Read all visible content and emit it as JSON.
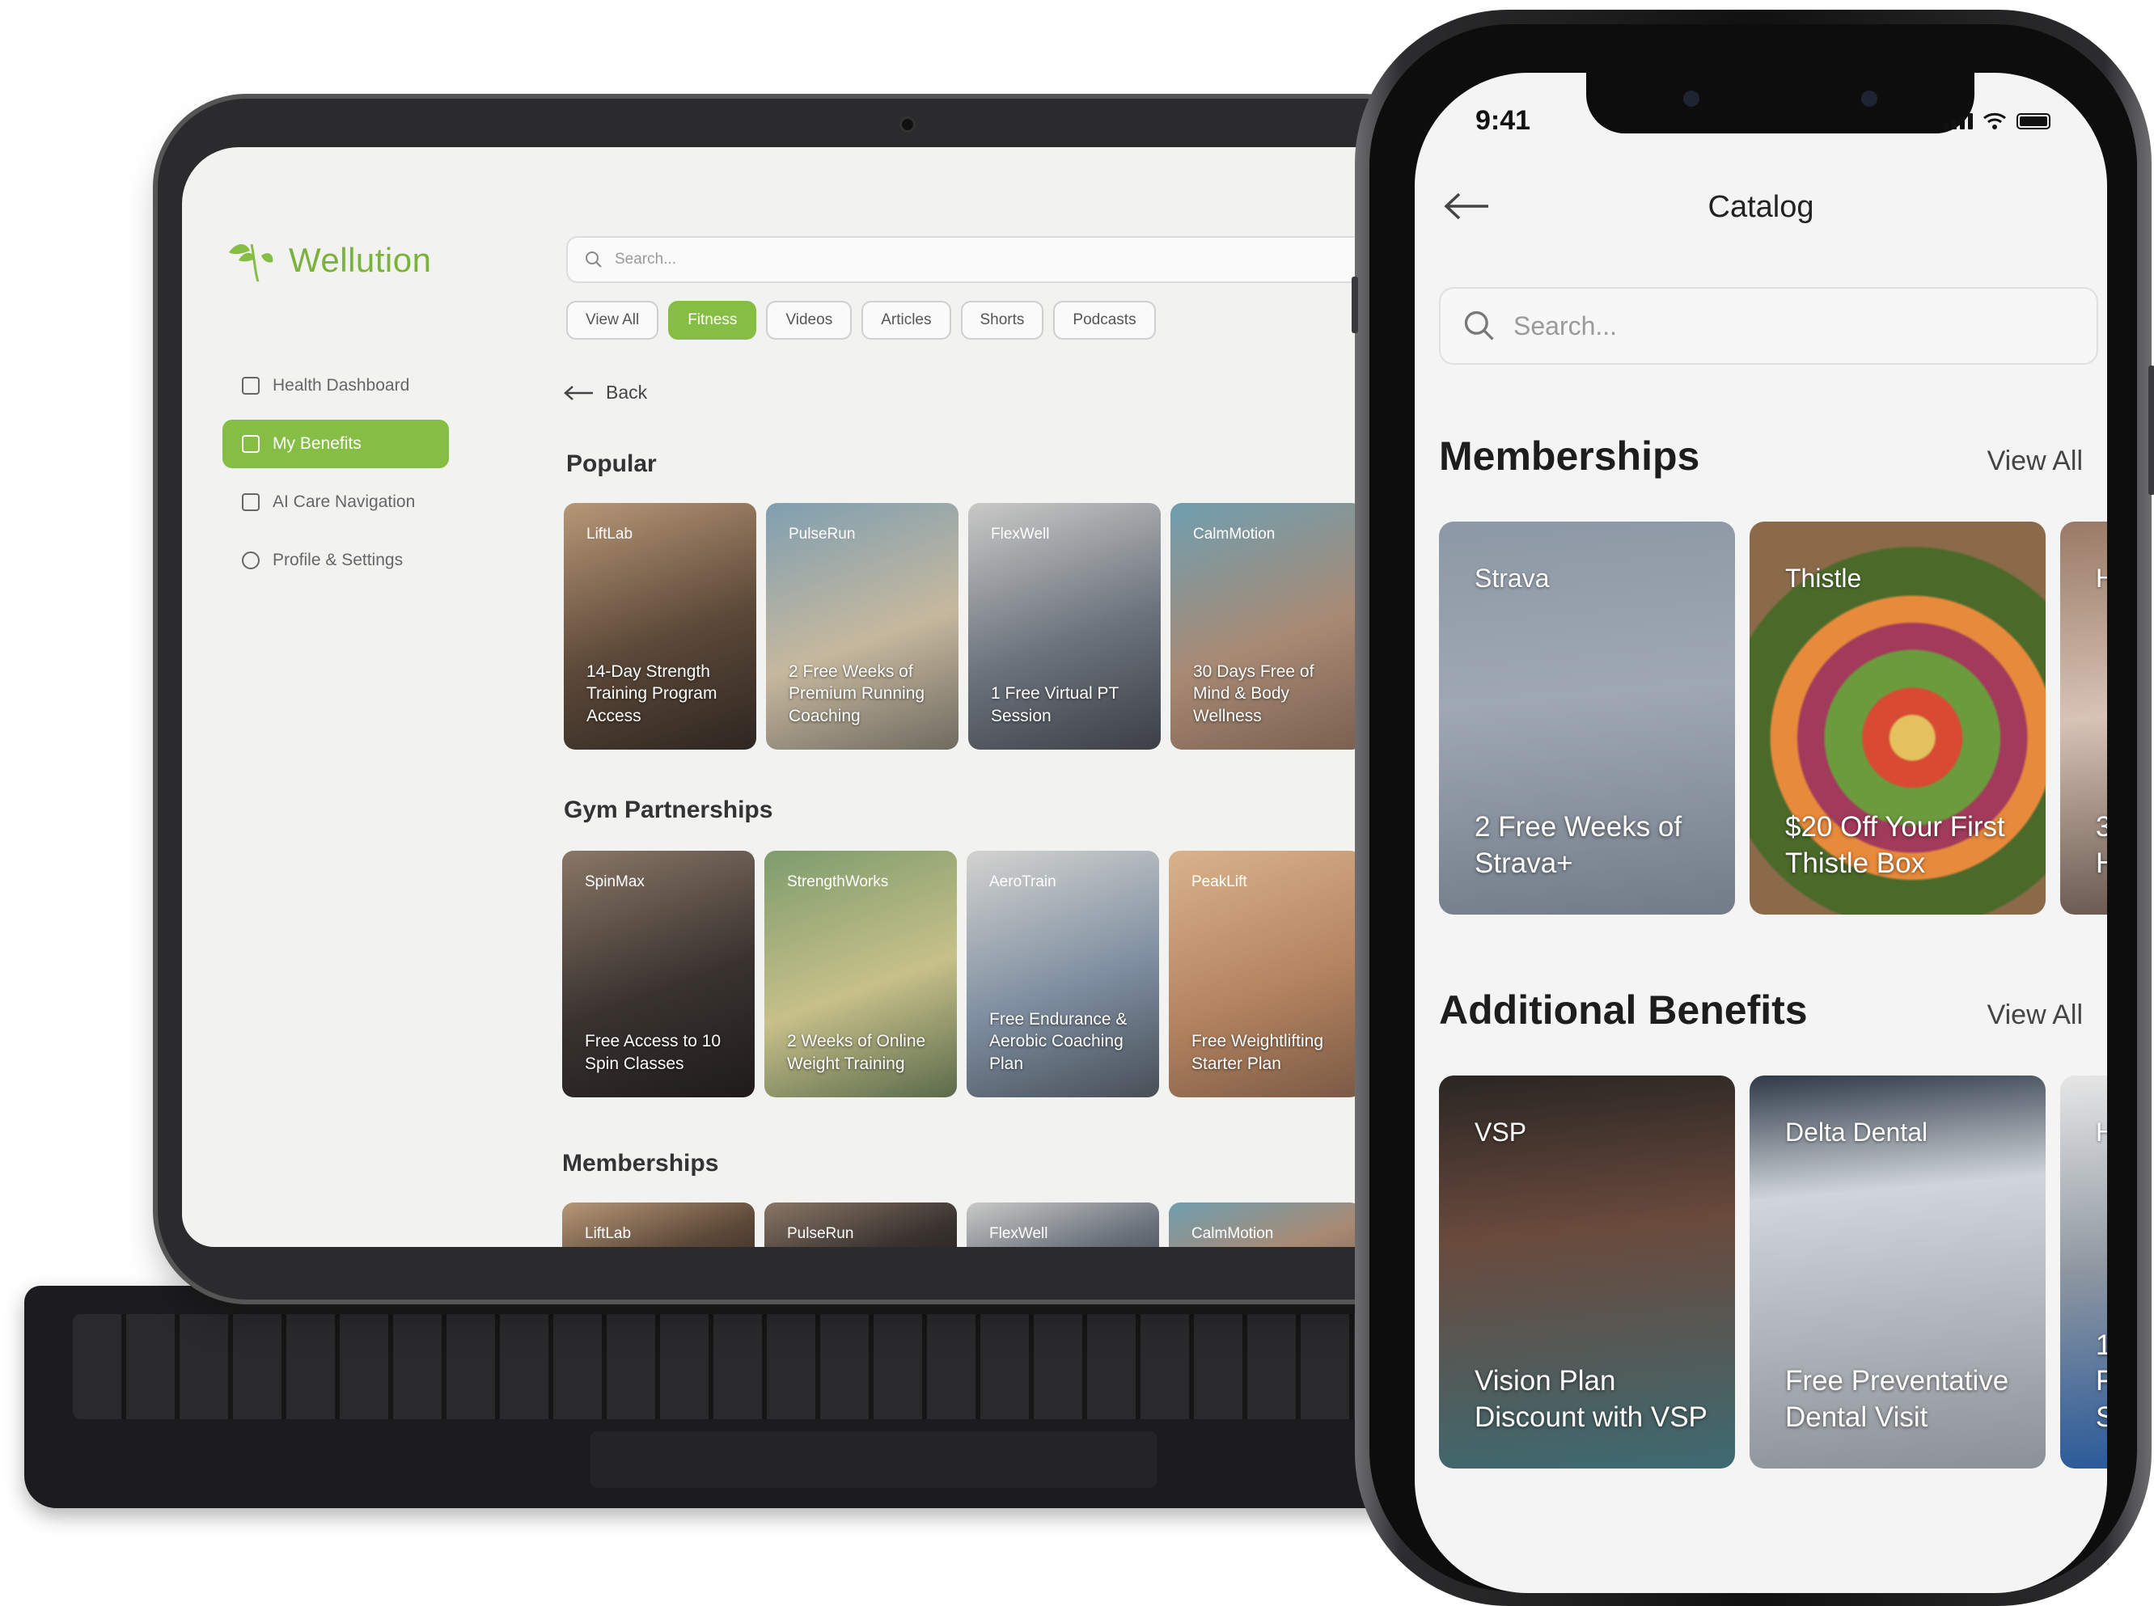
{
  "tablet": {
    "brand": "Wellution",
    "search_placeholder": "Search...",
    "nav": [
      {
        "label": "Health Dashboard",
        "active": false
      },
      {
        "label": "My Benefits",
        "active": true
      },
      {
        "label": "AI Care Navigation",
        "active": false
      },
      {
        "label": "Profile & Settings",
        "active": false
      }
    ],
    "chips": [
      {
        "label": "View All",
        "active": false
      },
      {
        "label": "Fitness",
        "active": true
      },
      {
        "label": "Videos",
        "active": false
      },
      {
        "label": "Articles",
        "active": false
      },
      {
        "label": "Shorts",
        "active": false
      },
      {
        "label": "Podcasts",
        "active": false
      }
    ],
    "back_label": "Back",
    "sections": [
      {
        "title": "Popular",
        "cards": [
          {
            "brand": "LiftLab",
            "offer": "14-Day Strength Training Program Access"
          },
          {
            "brand": "PulseRun",
            "offer": "2 Free Weeks of Premium Running Coaching"
          },
          {
            "brand": "FlexWell",
            "offer": "1 Free Virtual PT Session"
          },
          {
            "brand": "CalmMotion",
            "offer": "30 Days Free of Mind & Body Wellness"
          }
        ]
      },
      {
        "title": "Gym Partnerships",
        "cards": [
          {
            "brand": "SpinMax",
            "offer": "Free Access to 10 Spin Classes"
          },
          {
            "brand": "StrengthWorks",
            "offer": "2 Weeks of Online Weight Training"
          },
          {
            "brand": "AeroTrain",
            "offer": "Free Endurance & Aerobic Coaching Plan"
          },
          {
            "brand": "PeakLift",
            "offer": "Free Weightlifting Starter Plan"
          }
        ]
      },
      {
        "title": "Memberships",
        "cards": [
          {
            "brand": "LiftLab"
          },
          {
            "brand": "PulseRun"
          },
          {
            "brand": "FlexWell"
          },
          {
            "brand": "CalmMotion"
          }
        ]
      }
    ]
  },
  "phone": {
    "time": "9:41",
    "title": "Catalog",
    "search_placeholder": "Search...",
    "sections": [
      {
        "title": "Memberships",
        "view_all": "View All",
        "cards": [
          {
            "brand": "Strava",
            "offer": "2 Free Weeks of Strava+"
          },
          {
            "brand": "Thistle",
            "offer": "$20 Off Your First Thistle Box"
          },
          {
            "brand": "H",
            "offer": "3 H"
          }
        ]
      },
      {
        "title": "Additional Benefits",
        "view_all": "View All",
        "cards": [
          {
            "brand": "VSP",
            "offer": "Vision Plan Discount with VSP"
          },
          {
            "brand": "Delta Dental",
            "offer": "Free Preventative Dental Visit"
          },
          {
            "brand": "H",
            "offer": "1 F S"
          }
        ]
      }
    ]
  }
}
